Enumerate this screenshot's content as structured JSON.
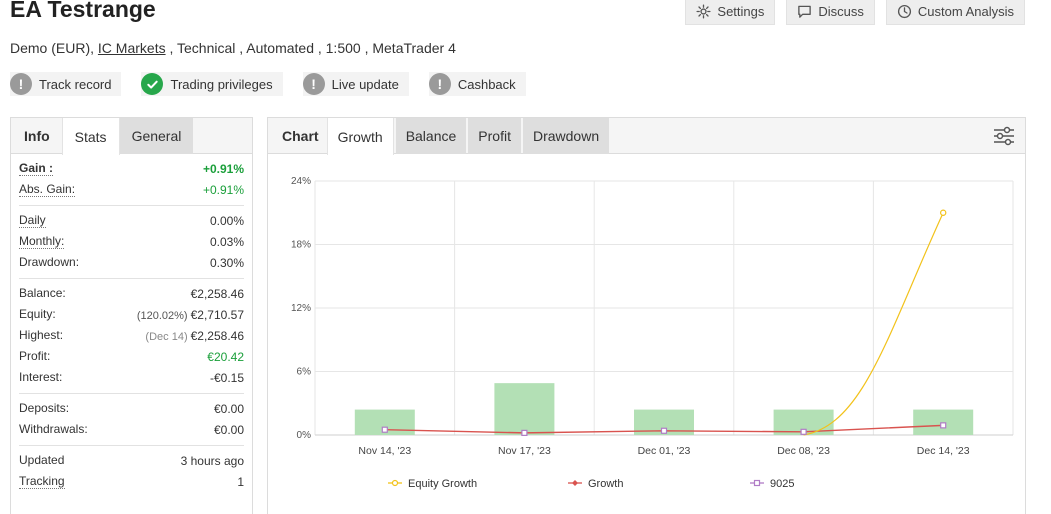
{
  "header": {
    "title": "EA Testrange",
    "subtitle_pre": "Demo (EUR), ",
    "broker_link": "IC Markets",
    "subtitle_post": " , Technical , Automated , 1:500 , MetaTrader 4"
  },
  "top_buttons": {
    "settings": "Settings",
    "discuss": "Discuss",
    "custom_analysis": "Custom Analysis"
  },
  "badges": [
    {
      "label": "Track record",
      "status": "warning",
      "icon": "exclamation-icon"
    },
    {
      "label": "Trading privileges",
      "status": "verified",
      "icon": "check-icon"
    },
    {
      "label": "Live update",
      "status": "warning",
      "icon": "exclamation-icon"
    },
    {
      "label": "Cashback",
      "status": "warning",
      "icon": "exclamation-icon"
    }
  ],
  "left_panel": {
    "tabs": {
      "head": "Info",
      "active": "Stats",
      "other": "General"
    },
    "rows": {
      "gain_label": "Gain :",
      "gain_value": "+0.91%",
      "abs_gain_label": "Abs. Gain:",
      "abs_gain_value": "+0.91%",
      "daily_label": "Daily",
      "daily_value": "0.00%",
      "monthly_label": "Monthly:",
      "monthly_value": "0.03%",
      "drawdown_label": "Drawdown:",
      "drawdown_value": "0.30%",
      "balance_label": "Balance:",
      "balance_value": "€2,258.46",
      "equity_label": "Equity:",
      "equity_note": "(120.02%)",
      "equity_value": "€2,710.57",
      "highest_label": "Highest:",
      "highest_note": "(Dec 14)",
      "highest_value": "€2,258.46",
      "profit_label": "Profit:",
      "profit_value": "€20.42",
      "interest_label": "Interest:",
      "interest_value": "-€0.15",
      "deposits_label": "Deposits:",
      "deposits_value": "€0.00",
      "withdrawals_label": "Withdrawals:",
      "withdrawals_value": "€0.00",
      "updated_label": "Updated",
      "updated_value": "3 hours ago",
      "tracking_label": "Tracking",
      "tracking_value": "1"
    }
  },
  "chart_panel": {
    "tabs": {
      "head": "Chart",
      "active": "Growth",
      "balance": "Balance",
      "profit": "Profit",
      "drawdown": "Drawdown"
    }
  },
  "colors": {
    "equity_line": "#f2c21b",
    "growth_line": "#d9534f",
    "series_9025": "#b07cc6",
    "bars": "#b3e0b5",
    "positive": "#1a9f3a"
  },
  "chart_data": {
    "type": "bar",
    "categories": [
      "Nov 14, '23",
      "Nov 17, '23",
      "Dec 01, '23",
      "Dec 08, '23",
      "Dec 14, '23"
    ],
    "y_tick_labels": [
      "0%",
      "6%",
      "12%",
      "18%",
      "24%"
    ],
    "ylim": [
      0,
      24
    ],
    "grid": true,
    "legend_position": "bottom",
    "series": [
      {
        "name": "Equity Growth",
        "kind": "line",
        "values": [
          null,
          null,
          null,
          0,
          21
        ]
      },
      {
        "name": "Growth",
        "kind": "line",
        "values": [
          0.5,
          0.2,
          0.4,
          0.3,
          0.91
        ]
      },
      {
        "name": "9025",
        "kind": "bar",
        "values": [
          2.4,
          4.9,
          2.4,
          2.4,
          2.4
        ]
      }
    ]
  }
}
